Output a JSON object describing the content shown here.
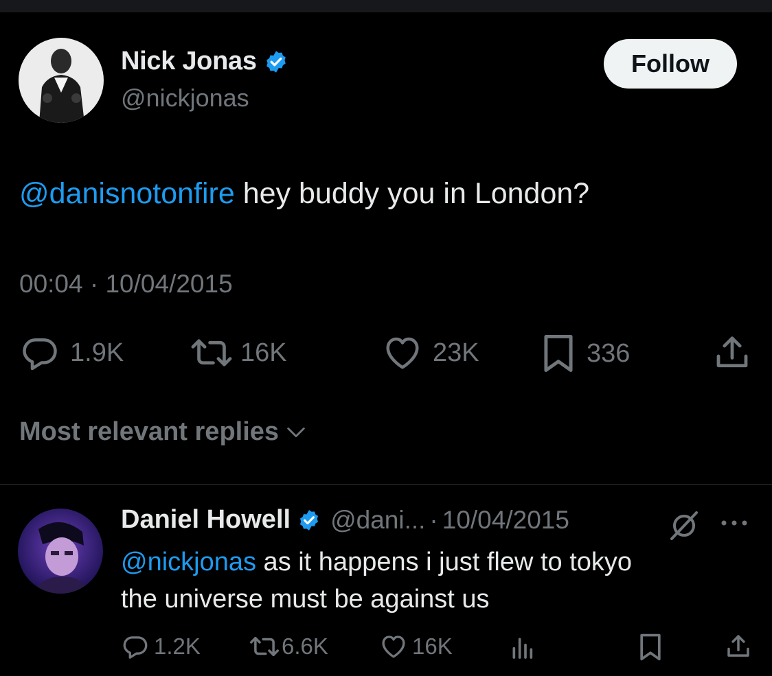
{
  "colors": {
    "background": "#000000",
    "text": "#e7e9ea",
    "muted": "#71767b",
    "accent": "#1d9bf0",
    "follow_bg": "#eff3f4"
  },
  "tweet": {
    "author_name": "Nick Jonas",
    "author_handle": "@nickjonas",
    "verified_icon": "verified-badge-icon",
    "follow_label": "Follow",
    "mention": "@danisnotonfire",
    "text": " hey buddy you in London?",
    "timestamp": "00:04 · 10/04/2015",
    "stats": {
      "replies": "1.9K",
      "retweets": "16K",
      "likes": "23K",
      "bookmarks": "336"
    }
  },
  "replies_section": {
    "label": "Most relevant replies"
  },
  "reply": {
    "author_name": "Daniel Howell",
    "author_handle": "@dani...",
    "separator": "·",
    "date": "10/04/2015",
    "mention": "@nickjonas",
    "text_line1": " as it happens i just flew to tokyo",
    "text_line2": "the universe must be against us",
    "stats": {
      "replies": "1.2K",
      "retweets": "6.6K",
      "likes": "16K"
    }
  }
}
